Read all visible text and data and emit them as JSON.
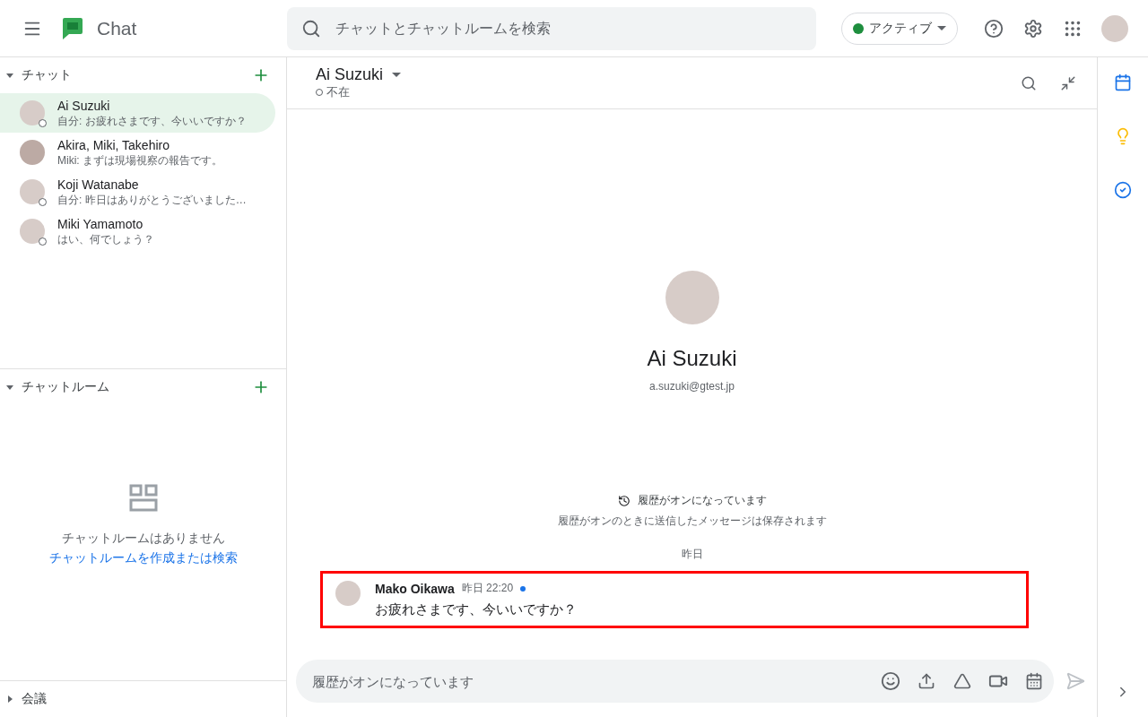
{
  "app": {
    "title": "Chat"
  },
  "search": {
    "placeholder": "チャットとチャットルームを検索"
  },
  "status": {
    "label": "アクティブ",
    "color": "#1e8e3e"
  },
  "sidebar": {
    "sections": [
      {
        "title": "チャット",
        "expanded": true,
        "kind": "list",
        "items": [
          {
            "name": "Ai Suzuki",
            "preview": "自分: お疲れさまです、今いいですか？",
            "selected": true,
            "away": true,
            "kind": "single"
          },
          {
            "name": "Akira, Miki, Takehiro",
            "preview": "Miki: まずは現場視察の報告です。",
            "selected": false,
            "away": false,
            "kind": "group"
          },
          {
            "name": "Koji Watanabe",
            "preview": "自分: 昨日はありがとうございました…",
            "selected": false,
            "away": true,
            "kind": "single"
          },
          {
            "name": "Miki Yamamoto",
            "preview": "はい、何でしょう？",
            "selected": false,
            "away": true,
            "kind": "single"
          }
        ]
      },
      {
        "title": "チャットルーム",
        "expanded": true,
        "kind": "empty",
        "empty_text": "チャットルームはありません",
        "link": "チャットルームを作成または検索"
      },
      {
        "title": "会議",
        "expanded": false,
        "kind": "collapsed"
      }
    ]
  },
  "conversation": {
    "title": "Ai Suzuki",
    "presence": "不在",
    "away": true,
    "profile": {
      "name": "Ai Suzuki",
      "email": "a.suzuki@gtest.jp"
    },
    "history": {
      "title": "履歴がオンになっています",
      "subtitle": "履歴がオンのときに送信したメッセージは保存されます"
    },
    "date_divider": "昨日",
    "messages": [
      {
        "sender": "Mako Oikawa",
        "time": "昨日 22:20",
        "text": "お疲れさまです、今いいですか？",
        "unread": true,
        "highlighted": true
      }
    ],
    "composer": {
      "placeholder": "履歴がオンになっています"
    }
  }
}
